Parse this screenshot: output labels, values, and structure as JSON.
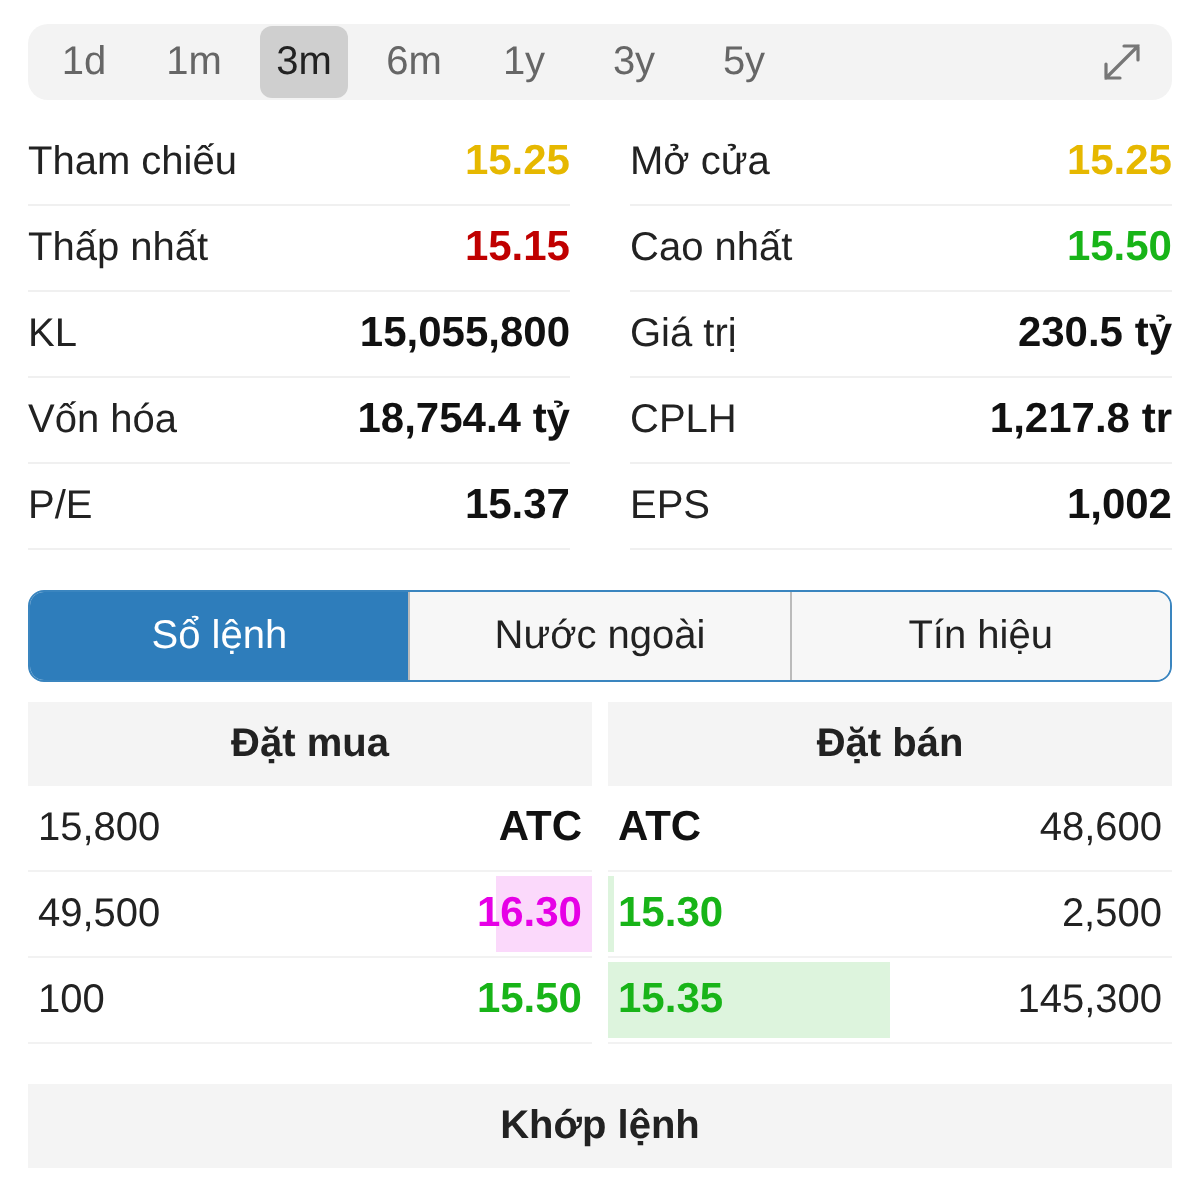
{
  "periods": [
    {
      "label": "1d",
      "selected": false
    },
    {
      "label": "1m",
      "selected": false
    },
    {
      "label": "3m",
      "selected": true
    },
    {
      "label": "6m",
      "selected": false
    },
    {
      "label": "1y",
      "selected": false
    },
    {
      "label": "3y",
      "selected": false
    },
    {
      "label": "5y",
      "selected": false
    }
  ],
  "stats": [
    {
      "label": "Tham chiếu",
      "value": "15.25",
      "color": "#e6b800"
    },
    {
      "label": "Mở cửa",
      "value": "15.25",
      "color": "#e6b800"
    },
    {
      "label": "Thấp nhất",
      "value": "15.15",
      "color": "#c00000"
    },
    {
      "label": "Cao nhất",
      "value": "15.50",
      "color": "#18b418"
    },
    {
      "label": "KL",
      "value": "15,055,800",
      "color": "#111111"
    },
    {
      "label": "Giá trị",
      "value": "230.5 tỷ",
      "color": "#111111"
    },
    {
      "label": "Vốn hóa",
      "value": "18,754.4 tỷ",
      "color": "#111111"
    },
    {
      "label": "CPLH",
      "value": "1,217.8 tr",
      "color": "#111111"
    },
    {
      "label": "P/E",
      "value": "15.37",
      "color": "#111111"
    },
    {
      "label": "EPS",
      "value": "1,002",
      "color": "#111111"
    }
  ],
  "tabs": [
    {
      "label": "Sổ lệnh",
      "selected": true
    },
    {
      "label": "Nước ngoài",
      "selected": false
    },
    {
      "label": "Tín hiệu",
      "selected": false
    }
  ],
  "order_book": {
    "buy_header": "Đặt mua",
    "sell_header": "Đặt bán",
    "rows": [
      {
        "buy": {
          "volume": "15,800",
          "price": "ATC",
          "color": "#111111"
        },
        "sell": {
          "price": "ATC",
          "color": "#111111",
          "volume": "48,600"
        }
      },
      {
        "buy": {
          "volume": "49,500",
          "price": "16.30",
          "color": "#e600e6",
          "level": 0.17
        },
        "sell": {
          "price": "15.30",
          "color": "#18b418",
          "level": 0.01,
          "volume": "2,500"
        }
      },
      {
        "buy": {
          "volume": "100",
          "price": "15.50",
          "color": "#18b418"
        },
        "sell": {
          "price": "15.35",
          "color": "#18b418",
          "level": 0.5,
          "volume": "145,300"
        }
      }
    ]
  },
  "matched": {
    "header": "Khớp lệnh"
  }
}
